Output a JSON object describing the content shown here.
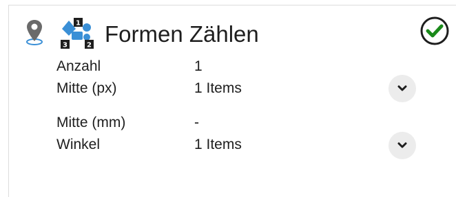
{
  "header": {
    "title": "Formen Zählen",
    "pin_icon": "location-pin-icon",
    "shapes_icon": "count-shapes-icon",
    "status_icon": "check-circle-icon",
    "accent_color": "#3a8fd6",
    "status_color": "#1a8a1a"
  },
  "rows": [
    {
      "label": "Anzahl",
      "value": "1"
    },
    {
      "label": "Mitte (px)",
      "value": "1 Items"
    },
    {
      "label": "Mitte (mm)",
      "value": "-"
    },
    {
      "label": "Winkel",
      "value": "1 Items"
    }
  ],
  "shapes_icon_numbers": [
    "1",
    "2",
    "3"
  ]
}
